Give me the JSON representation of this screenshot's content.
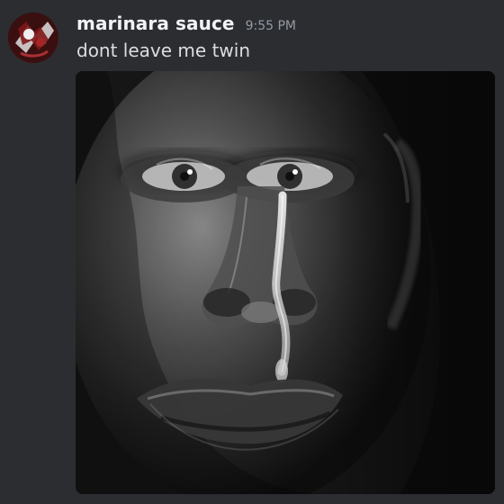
{
  "message": {
    "author": {
      "name": "marinara sauce",
      "avatar_icon": "user-avatar-icon"
    },
    "timestamp": "9:55 PM",
    "text": "dont leave me twin",
    "attachment": {
      "icon": "image-attachment-icon",
      "description_color_scheme": [
        "#121212",
        "#3c3c3c",
        "#b5b5b5"
      ]
    }
  },
  "colors": {
    "background": "#2b2d31",
    "username": "#f2f3f5",
    "timestamp": "#949ba4",
    "message_text": "#dbdee1"
  }
}
